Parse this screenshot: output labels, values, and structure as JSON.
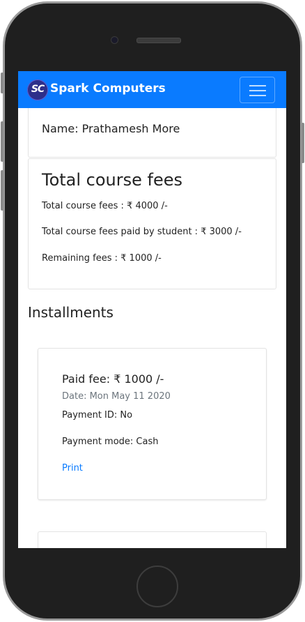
{
  "app": {
    "logo_text": "SC",
    "brand": "Spark Computers"
  },
  "student": {
    "name_line": "Name: Prathamesh More"
  },
  "fees": {
    "title": "Total course fees",
    "total_line": "Total course fees : ₹ 4000 /-",
    "paid_line": "Total course fees paid by student : ₹ 3000 /-",
    "remaining_line": "Remaining fees : ₹ 1000 /-"
  },
  "installments": {
    "title": "Installments",
    "items": [
      {
        "paid": "Paid fee: ₹ 1000 /-",
        "date": "Date: Mon May 11 2020",
        "payment_id": "Payment ID: No",
        "payment_mode": "Payment mode: Cash",
        "print_label": "Print"
      }
    ]
  },
  "colors": {
    "navbar": "#0a7bff",
    "link": "#0a7bff",
    "muted": "#6c757d"
  }
}
